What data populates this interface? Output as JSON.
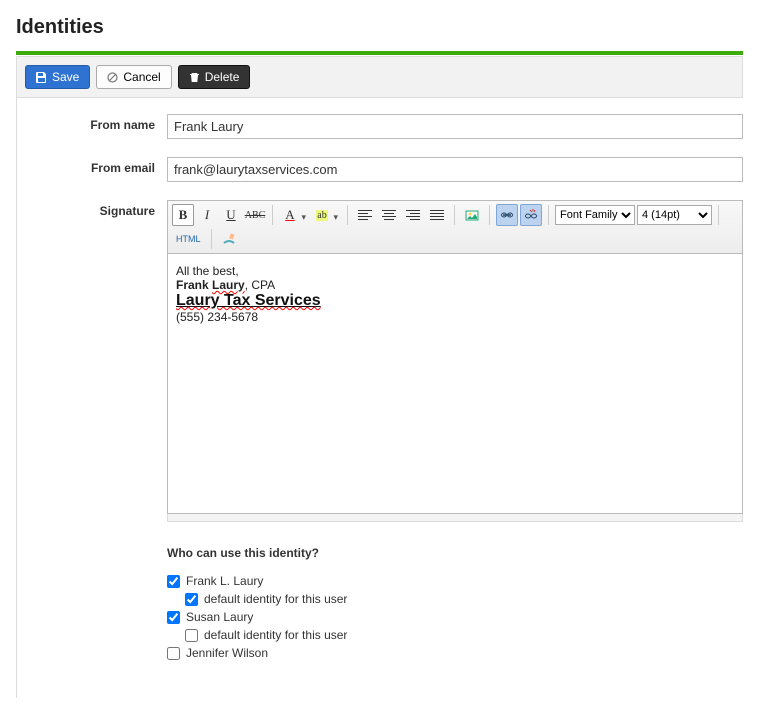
{
  "page": {
    "title": "Identities"
  },
  "toolbar": {
    "save": "Save",
    "cancel": "Cancel",
    "delete": "Delete"
  },
  "form": {
    "from_name_label": "From name",
    "from_name_value": "Frank Laury",
    "from_email_label": "From email",
    "from_email_value": "frank@laurytaxservices.com",
    "signature_label": "Signature"
  },
  "editor": {
    "font_family_selected": "Font Family",
    "font_size_selected": "4 (14pt)",
    "html_label": "HTML",
    "signature": {
      "line1": "All the best,",
      "name_first": "Frank",
      "name_last": "Laury",
      "name_suffix": ", CPA",
      "link_text": "Laury Tax Services",
      "phone": "(555) 234-5678"
    }
  },
  "access": {
    "heading": "Who can use this identity?",
    "default_label": "default identity for this user",
    "users": [
      {
        "name": "Frank L. Laury",
        "checked": true,
        "default_checked": true,
        "show_default": true
      },
      {
        "name": "Susan Laury",
        "checked": true,
        "default_checked": false,
        "show_default": true
      },
      {
        "name": "Jennifer Wilson",
        "checked": false,
        "default_checked": false,
        "show_default": false
      }
    ]
  }
}
